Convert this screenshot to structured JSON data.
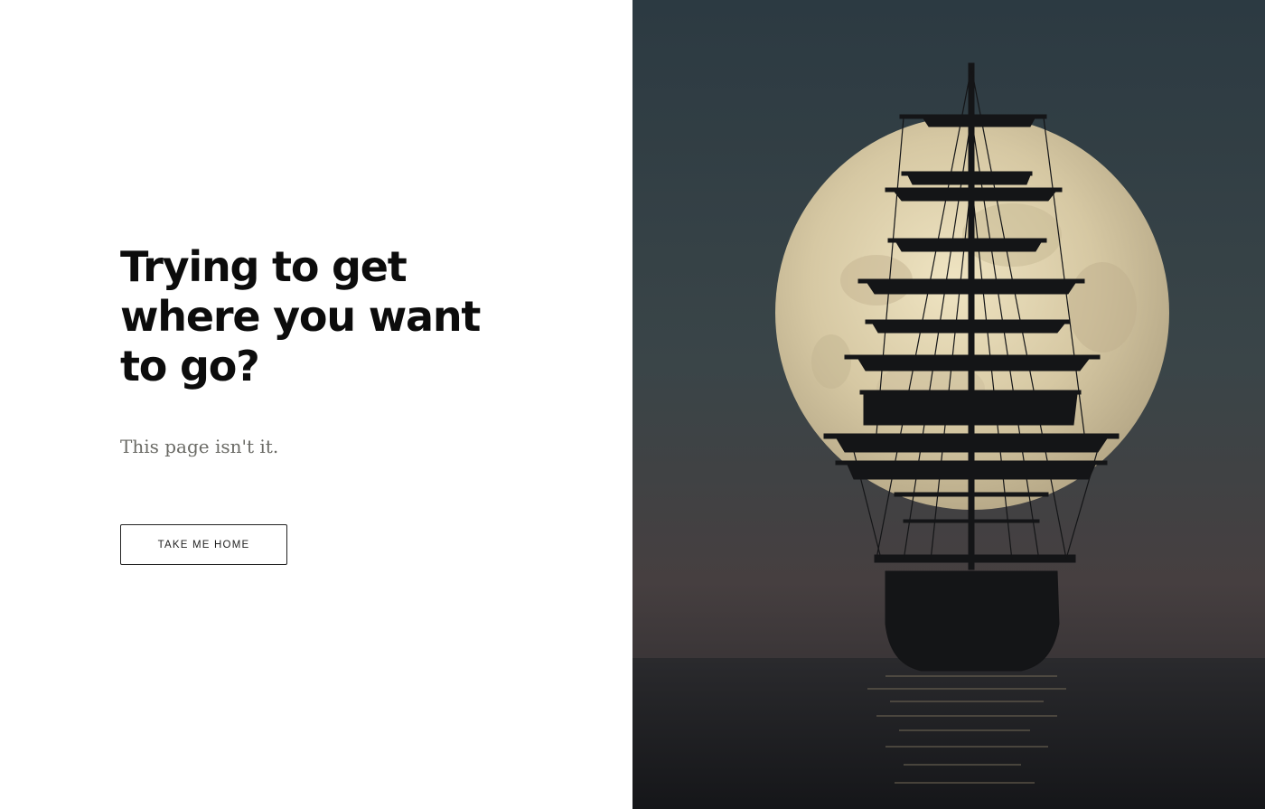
{
  "main": {
    "headline": "Trying to get where you want to go?",
    "subtext": "This page isn't it.",
    "home_button_label": "TAKE ME HOME"
  },
  "image": {
    "subject": "tall ship silhouette in front of full moon over the sea"
  },
  "colors": {
    "headline": "#0c0c0c",
    "subtext": "#6b6b66",
    "button_border": "#222222",
    "sky_top": "#2d3a42",
    "sky_bottom": "#4a4244",
    "moon": "#d9ccaa",
    "sea": "#1f2124"
  }
}
